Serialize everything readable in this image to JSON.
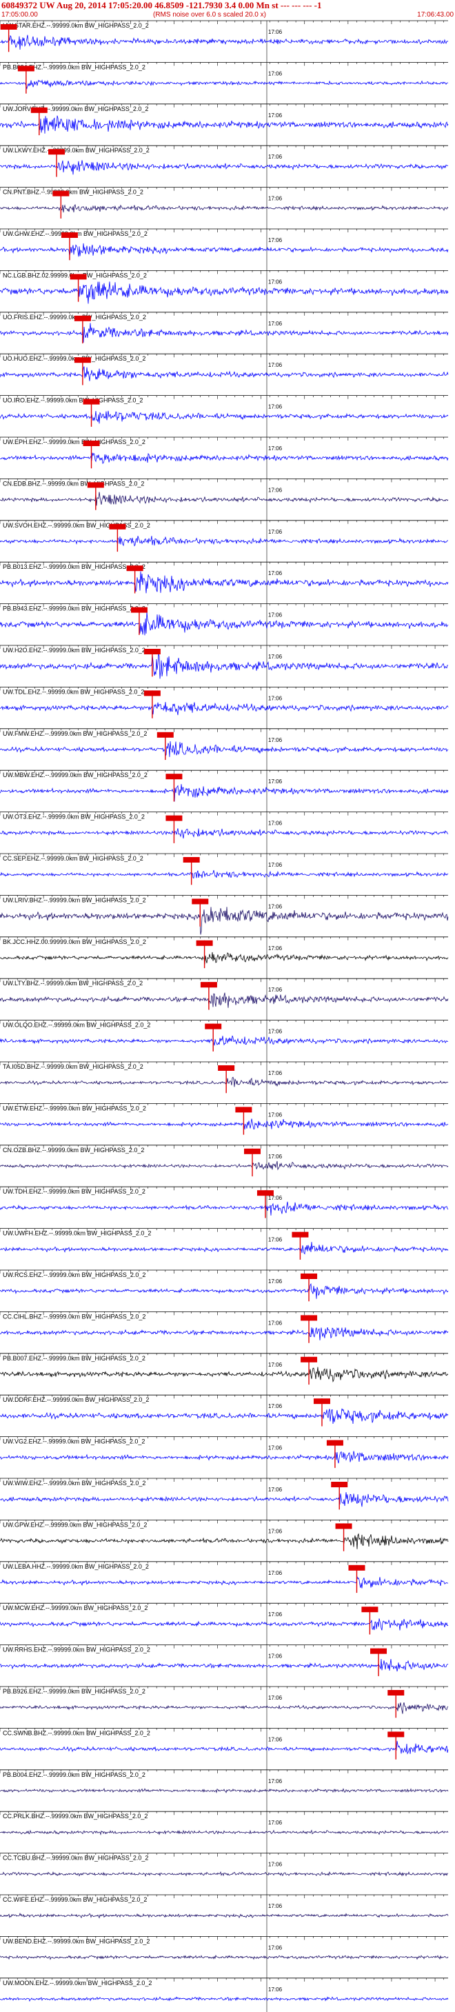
{
  "header": {
    "title": "60849372 UW Aug 20, 2014 17:05:20.00   46.8509  -121.7930  3.4 0.00 Mn st --- --- ---  -1",
    "start_time": "17:05:00.00",
    "note": "(RMS noise over 6.0 s scaled 20.0 x)",
    "end_time": "17:06:43.00"
  },
  "time_mark": "17:06",
  "colors": {
    "trace_blue": "#0000ff",
    "trace_black": "#000000",
    "trace_navy": "#1a0d66",
    "pick": "#e00000",
    "axis": "#000000"
  },
  "chart_data": {
    "type": "seismogram",
    "time_start": "17:05:00.00",
    "time_end": "17:06:43.00",
    "traces": [
      {
        "label": "UW.STAR.EHZ.--.99999.0km BW_HIGHPASS_2.0_2",
        "color": "blue",
        "pick": 2,
        "amp": 0.5
      },
      {
        "label": "PB.B024.EHZ.--.99999.0km BW_HIGHPASS_2.0_2",
        "color": "blue",
        "pick": 6,
        "amp": 0.3
      },
      {
        "label": "UW.JORV.EHZ.--.99999.0km BW_HIGHPASS_2.0_2",
        "color": "blue",
        "pick": 9,
        "amp": 0.8
      },
      {
        "label": "UW.LKWY.EHZ.--.99999.0km BW_HIGHPASS_2.0_2",
        "color": "blue",
        "pick": 13,
        "amp": 0.5
      },
      {
        "label": "CN.PNT.BHZ.--.99999.0km BW_HIGHPASS_2.0_2",
        "color": "navy",
        "pick": 14,
        "amp": 0.3
      },
      {
        "label": "UW.GHW.EHZ.--.99999.0km BW_HIGHPASS_2.0_2",
        "color": "blue",
        "pick": 16,
        "amp": 0.5
      },
      {
        "label": "NC.LGB.BHZ.02.99999.0km BW_HIGHPASS_2.0_2",
        "color": "blue",
        "pick": 18,
        "amp": 0.9
      },
      {
        "label": "UO.FRIS.EHZ.--.99999.0km BW_HIGHPASS_2.0_2",
        "color": "blue",
        "pick": 19,
        "amp": 0.5
      },
      {
        "label": "UO.HUO.EHZ.--.99999.0km BW_HIGHPASS_2.0_2",
        "color": "blue",
        "pick": 19,
        "amp": 0.5
      },
      {
        "label": "UO.IRO.EHZ.--.99999.0km BW_HIGHPASS_2.0_2",
        "color": "blue",
        "pick": 21,
        "amp": 0.5
      },
      {
        "label": "UW.EPH.EHZ.--.99999.0km BW_HIGHPASS_2.0_2",
        "color": "blue",
        "pick": 21,
        "amp": 0.5
      },
      {
        "label": "CN.EDB.BHZ.--.99999.0km BW_HIGHPASS_2.0_2",
        "color": "navy",
        "pick": 22,
        "amp": 0.4
      },
      {
        "label": "UW.SVOH.EHZ.--.99999.0km BW_HIGHPASS_2.0_2",
        "color": "blue",
        "pick": 27,
        "amp": 0.4
      },
      {
        "label": "PB.B013.EHZ.--.99999.0km BW_HIGHPASS_2.0_2",
        "color": "blue",
        "pick": 31,
        "amp": 0.8
      },
      {
        "label": "PB.B943.EHZ.--.99999.0km BW_HIGHPASS_2.0_2",
        "color": "blue",
        "pick": 32,
        "amp": 0.8
      },
      {
        "label": "UW.H2O.EHZ.--.99999.0km BW_HIGHPASS_2.0_2",
        "color": "blue",
        "pick": 35,
        "amp": 0.8
      },
      {
        "label": "UW.TDL.EHZ.--.99999.0km BW_HIGHPASS_2.0_2",
        "color": "blue",
        "pick": 35,
        "amp": 0.6
      },
      {
        "label": "UW.FMW.EHZ.--.99999.0km BW_HIGHPASS_2.0_2",
        "color": "blue",
        "pick": 38,
        "amp": 0.5
      },
      {
        "label": "UW.MBW.EHZ.--.99999.0km BW_HIGHPASS_2.0_2",
        "color": "blue",
        "pick": 40,
        "amp": 0.5
      },
      {
        "label": "UW.OT3.EHZ.--.99999.0km BW_HIGHPASS_2.0_2",
        "color": "blue",
        "pick": 40,
        "amp": 0.4
      },
      {
        "label": "CC.SEP.EHZ.--.99999.0km BW_HIGHPASS_2.0_2",
        "color": "blue",
        "pick": 44,
        "amp": 0.3
      },
      {
        "label": "UW.LRIV.BHZ.--.99999.0km BW_HIGHPASS_2.0_2",
        "color": "navy",
        "pick": 46,
        "amp": 0.9
      },
      {
        "label": "BK.JCC.HHZ.00.99999.0km BW_HIGHPASS_2.0_2",
        "color": "black",
        "pick": 47,
        "amp": 0.4
      },
      {
        "label": "UW.LTY.BHZ.--.99999.0km BW_HIGHPASS_2.0_2",
        "color": "navy",
        "pick": 48,
        "amp": 0.6
      },
      {
        "label": "UW.OLQO.EHZ.--.99999.0km BW_HIGHPASS_2.0_2",
        "color": "blue",
        "pick": 49,
        "amp": 0.4
      },
      {
        "label": "TA.I05D.BHZ.--.99999.0km BW_HIGHPASS_2.0_2",
        "color": "navy",
        "pick": 52,
        "amp": 0.3
      },
      {
        "label": "UW.ETW.EHZ.--.99999.0km BW_HIGHPASS_2.0_2",
        "color": "blue",
        "pick": 56,
        "amp": 0.4
      },
      {
        "label": "CN.OZB.BHZ.--.99999.0km BW_HIGHPASS_2.0_2",
        "color": "navy",
        "pick": 58,
        "amp": 0.3
      },
      {
        "label": "UW.TDH.EHZ.--.99999.0km BW_HIGHPASS_2.0_2",
        "color": "blue",
        "pick": 61,
        "amp": 0.4
      },
      {
        "label": "UW.UWFH.EHZ.--.99999.0km BW_HIGHPASS_2.0_2",
        "color": "blue",
        "pick": 69,
        "amp": 0.4
      },
      {
        "label": "UW.RCS.EHZ.--.99999.0km BW_HIGHPASS_2.0_2",
        "color": "blue",
        "pick": 71,
        "amp": 0.4
      },
      {
        "label": "CC.CIHL.BHZ.--.99999.0km BW_HIGHPASS_2.0_2",
        "color": "blue",
        "pick": 71,
        "amp": 0.5
      },
      {
        "label": "PB.B007.EHZ.--.99999.0km BW_HIGHPASS_2.0_2",
        "color": "black",
        "pick": 71,
        "amp": 0.6
      },
      {
        "label": "UW.DDRF.EHZ.--.99999.0km BW_HIGHPASS_2.0_2",
        "color": "blue",
        "pick": 74,
        "amp": 0.7
      },
      {
        "label": "UW.VG2.EHZ.--.99999.0km BW_HIGHPASS_2.0_2",
        "color": "blue",
        "pick": 77,
        "amp": 0.5
      },
      {
        "label": "UW.WIW.EHZ.--.99999.0km BW_HIGHPASS_2.0_2",
        "color": "blue",
        "pick": 78,
        "amp": 0.5
      },
      {
        "label": "UW.GPW.EHZ.--.99999.0km BW_HIGHPASS_2.0_2",
        "color": "black",
        "pick": 79,
        "amp": 0.5
      },
      {
        "label": "UW.LEBA.HHZ.--.99999.0km BW_HIGHPASS_2.0_2",
        "color": "blue",
        "pick": 82,
        "amp": 0.4
      },
      {
        "label": "UW.MCW.EHZ.--.99999.0km BW_HIGHPASS_2.0_2",
        "color": "blue",
        "pick": 85,
        "amp": 0.5
      },
      {
        "label": "UW.RRHS.EHZ.--.99999.0km BW_HIGHPASS_2.0_2",
        "color": "blue",
        "pick": 87,
        "amp": 0.5
      },
      {
        "label": "PB.B926.EHZ.--.99999.0km BW_HIGHPASS_2.0_2",
        "color": "navy",
        "pick": 91,
        "amp": 0.3
      },
      {
        "label": "CC.SWNB.BHZ.--.99999.0km BW_HIGHPASS_2.0_2",
        "color": "blue",
        "pick": 91,
        "amp": 0.4
      },
      {
        "label": "PB.B004.EHZ.--.99999.0km BW_HIGHPASS_2.0_2",
        "color": "navy",
        "pick": null,
        "amp": 0.3
      },
      {
        "label": "CC.PRLK.BHZ.--.99999.0km BW_HIGHPASS_2.0_2",
        "color": "navy",
        "pick": null,
        "amp": 0.3
      },
      {
        "label": "CC.TCBU.BHZ.--.99999.0km BW_HIGHPASS_2.0_2",
        "color": "navy",
        "pick": null,
        "amp": 0.3
      },
      {
        "label": "CC.WIFE.EHZ.--.99999.0km BW_HIGHPASS_2.0_2",
        "color": "navy",
        "pick": null,
        "amp": 0.3
      },
      {
        "label": "UW.BEND.EHZ.--.99999.0km BW_HIGHPASS_2.0_2",
        "color": "navy",
        "pick": null,
        "amp": 0.3
      },
      {
        "label": "UW.MOON.EHZ.--.99999.0km BW_HIGHPASS_2.0_2",
        "color": "blue",
        "pick": null,
        "amp": 0.3
      }
    ]
  }
}
